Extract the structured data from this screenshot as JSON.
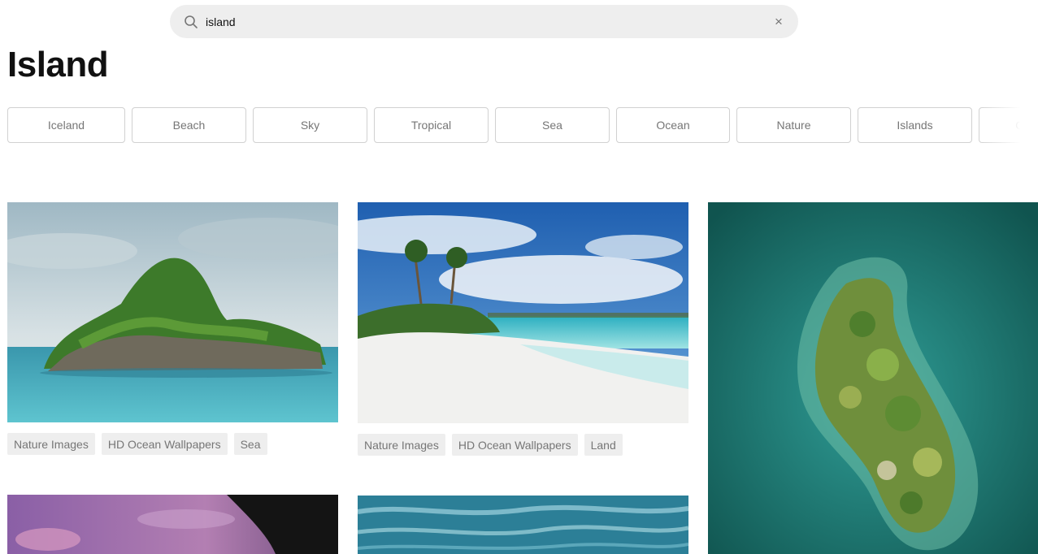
{
  "search": {
    "query": "island",
    "clear_glyph": "×",
    "icons": {
      "search": "search-icon",
      "clear": "close-icon"
    }
  },
  "page_title": "Island",
  "related_searches": [
    "Iceland",
    "Beach",
    "Sky",
    "Tropical",
    "Sea",
    "Ocean",
    "Nature",
    "Islands",
    "Outdoor"
  ],
  "photos": [
    {
      "subject": "rocky green island in turquoise sea",
      "tags": [
        "Nature Images",
        "HD Ocean Wallpapers",
        "Sea"
      ]
    },
    {
      "subject": "white sand beach with palm trees and turquoise water",
      "tags": [
        "Nature Images",
        "HD Ocean Wallpapers",
        "Land"
      ]
    },
    {
      "subject": "aerial view of forested island surrounded by teal water",
      "tags": []
    },
    {
      "subject": "purple sunset sky with tree silhouette",
      "tags": []
    },
    {
      "subject": "aerial ocean waves",
      "tags": []
    }
  ],
  "colors": {
    "search_bg": "#eeeeee",
    "chip_border": "#d1d1d1",
    "tag_bg": "#eeeeee",
    "muted_text": "#767676"
  }
}
